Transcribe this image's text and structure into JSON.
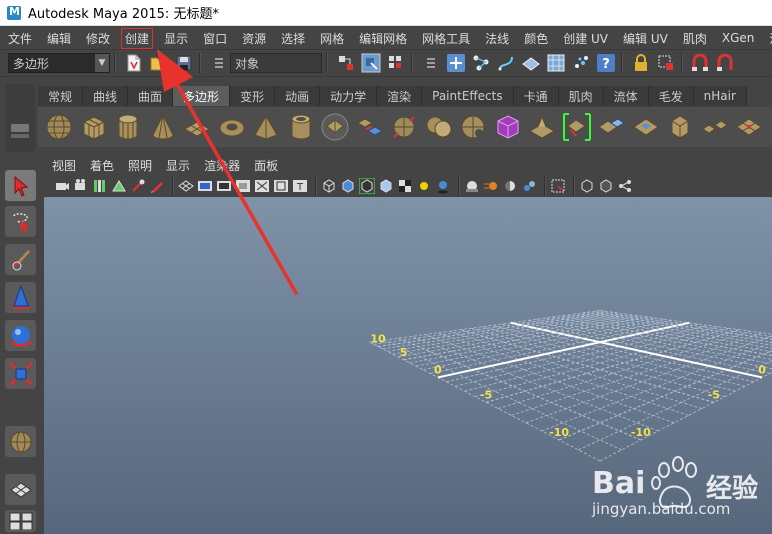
{
  "window": {
    "title": "Autodesk Maya 2015: 无标题*"
  },
  "menubar": {
    "items": [
      {
        "label": "文件"
      },
      {
        "label": "编辑"
      },
      {
        "label": "修改"
      },
      {
        "label": "创建",
        "highlighted": true
      },
      {
        "label": "显示"
      },
      {
        "label": "窗口"
      },
      {
        "label": "资源"
      },
      {
        "label": "选择"
      },
      {
        "label": "网格"
      },
      {
        "label": "编辑网格"
      },
      {
        "label": "网格工具"
      },
      {
        "label": "法线"
      },
      {
        "label": "颜色"
      },
      {
        "label": "创建 UV"
      },
      {
        "label": "编辑 UV"
      },
      {
        "label": "肌肉"
      },
      {
        "label": "XGen"
      },
      {
        "label": "流"
      }
    ]
  },
  "statusline": {
    "mode_value": "多边形",
    "object_field_value": "对象"
  },
  "shelf": {
    "tabs": [
      {
        "label": "常规"
      },
      {
        "label": "曲线"
      },
      {
        "label": "曲面"
      },
      {
        "label": "多边形",
        "active": true
      },
      {
        "label": "变形"
      },
      {
        "label": "动画"
      },
      {
        "label": "动力学"
      },
      {
        "label": "渲染"
      },
      {
        "label": "PaintEffects"
      },
      {
        "label": "卡通"
      },
      {
        "label": "肌肉"
      },
      {
        "label": "流体"
      },
      {
        "label": "毛发"
      },
      {
        "label": "nHair"
      }
    ]
  },
  "panel": {
    "menu": [
      {
        "label": "视图"
      },
      {
        "label": "着色"
      },
      {
        "label": "照明"
      },
      {
        "label": "显示"
      },
      {
        "label": "渲染器"
      },
      {
        "label": "面板"
      }
    ]
  },
  "grid": {
    "labels": [
      "-10",
      "-10",
      "-5",
      "-5",
      "0",
      "0",
      "5",
      "10"
    ]
  },
  "watermark": {
    "brand_latin": "Bai",
    "brand_cn": "经验",
    "url": "jingyan.baidu.com"
  },
  "colors": {
    "ui_background": "#444444",
    "viewport_top": "#7f92a8",
    "viewport_bottom": "#57677b",
    "annotation": "#e8322e",
    "grid_line": "#b3bfcd",
    "grid_label": "#f2e34a",
    "active_tab": "#5d5d5d"
  }
}
